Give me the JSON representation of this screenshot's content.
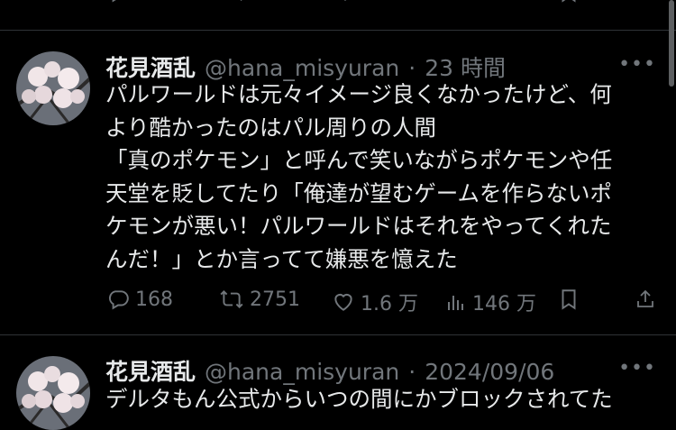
{
  "tweets": [
    {
      "name": "花見酒乱",
      "handle": "@hana_misyuran",
      "separator": "·",
      "time": "23 時間",
      "lines": [
        "パルワールドは元々イメージ良くなかったけど、何",
        "より酷かったのはパル周りの人間",
        "「真のポケモン」と呼んで笑いながらポケモンや任",
        "天堂を貶してたり「俺達が望むゲームを作らないポ",
        "ケモンが悪い！パルワールドはそれをやってくれた",
        "んだ！」とか言ってて嫌悪を憶えた"
      ],
      "replies": "168",
      "reposts": "2751",
      "likes": "1.6 万",
      "views": "146 万"
    },
    {
      "name": "花見酒乱",
      "handle": "@hana_misyuran",
      "separator": "·",
      "time": "2024/09/06",
      "lines": [
        "デルタもん公式からいつの間にかブロックされてた"
      ]
    }
  ],
  "more_label": "•••",
  "icons": {
    "reply": "reply-icon",
    "repost": "repost-icon",
    "like": "heart-icon",
    "views": "views-icon",
    "bookmark": "bookmark-icon",
    "share": "share-icon",
    "more": "more-icon"
  },
  "colors": {
    "background": "#000000",
    "text": "#e7e9ea",
    "muted": "#71767b",
    "divider": "#2f3336"
  }
}
